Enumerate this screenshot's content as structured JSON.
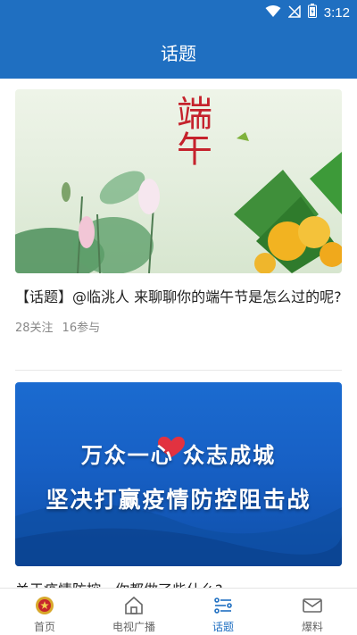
{
  "status_bar": {
    "time": "3:12",
    "icons": [
      "wifi-icon",
      "no-signal-icon",
      "battery-icon"
    ]
  },
  "app_bar": {
    "title": "话题"
  },
  "topics": [
    {
      "image_text": "端午",
      "title": "【话题】@临洮人 来聊聊你的端午节是怎么过的呢?",
      "follows": "28关注",
      "participants": "16参与"
    },
    {
      "image_text_line1": "万众一心 众志成城",
      "image_text_line2": "坚决打赢疫情防控阻击战",
      "title": "关于疫情防控，你都做了些什么?"
    }
  ],
  "bottom_nav": {
    "items": [
      {
        "label": "首页",
        "icon": "emblem-icon"
      },
      {
        "label": "电视广播",
        "icon": "home-icon"
      },
      {
        "label": "话题",
        "icon": "topic-list-icon",
        "active": true
      },
      {
        "label": "爆料",
        "icon": "mail-icon"
      }
    ],
    "active_color": "#1f6fc1"
  },
  "colors": {
    "primary": "#1f6fc1",
    "text": "#222222",
    "meta": "#888888"
  }
}
